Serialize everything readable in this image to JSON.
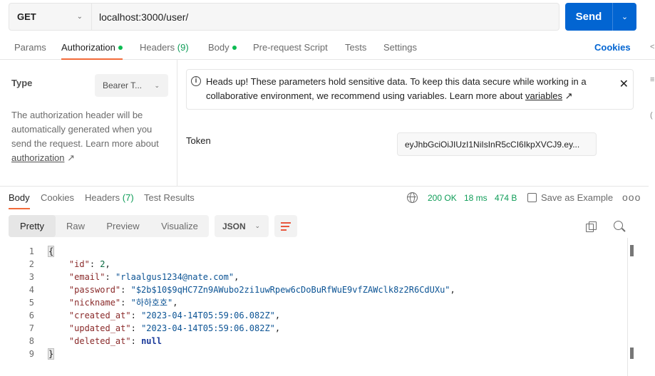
{
  "request": {
    "method": "GET",
    "url": "localhost:3000/user/",
    "send_label": "Send"
  },
  "request_tabs": [
    {
      "label": "Params"
    },
    {
      "label": "Authorization"
    },
    {
      "label": "Headers",
      "count": "(9)"
    },
    {
      "label": "Body"
    },
    {
      "label": "Pre-request Script"
    },
    {
      "label": "Tests"
    },
    {
      "label": "Settings"
    }
  ],
  "cookies_label": "Cookies",
  "auth": {
    "type_label": "Type",
    "type_value": "Bearer T...",
    "desc": "The authorization header will be automatically generated when you send the request. Learn more about ",
    "desc_link": "authorization",
    "notice_text": "Heads up! These parameters hold sensitive data. To keep this data secure while working in a collaborative environment, we recommend using variables. Learn more about ",
    "notice_link": "variables",
    "token_label": "Token",
    "token_value": "eyJhbGciOiJIUzI1NiIsInR5cCI6IkpXVCJ9.ey..."
  },
  "response_tabs": [
    {
      "label": "Body"
    },
    {
      "label": "Cookies"
    },
    {
      "label": "Headers",
      "count": "(7)"
    },
    {
      "label": "Test Results"
    }
  ],
  "response_status": {
    "status": "200 OK",
    "time": "18 ms",
    "size": "474 B",
    "save_label": "Save as Example",
    "more": "ooo"
  },
  "view_modes": [
    "Pretty",
    "Raw",
    "Preview",
    "Visualize"
  ],
  "format": "JSON",
  "body_json": {
    "id": "2",
    "email": "\"rlaalgus1234@nate.com\"",
    "password": "\"$2b$10$9qHC7Zn9AWubo2zi1uwRpew6cDoBuRfWuE9vfZAWclk8z2R6CdUXu\"",
    "nickname": "\"하하호호\"",
    "created_at": "\"2023-04-14T05:59:06.082Z\"",
    "updated_at": "\"2023-04-14T05:59:06.082Z\"",
    "deleted_at": "null"
  },
  "line_numbers": [
    "1",
    "2",
    "3",
    "4",
    "5",
    "6",
    "7",
    "8",
    "9"
  ],
  "edge_glyphs": [
    "<",
    "≡",
    "("
  ],
  "colors": {
    "accent": "#f26b3a",
    "send": "#0265d2",
    "success": "#0f9d58"
  }
}
